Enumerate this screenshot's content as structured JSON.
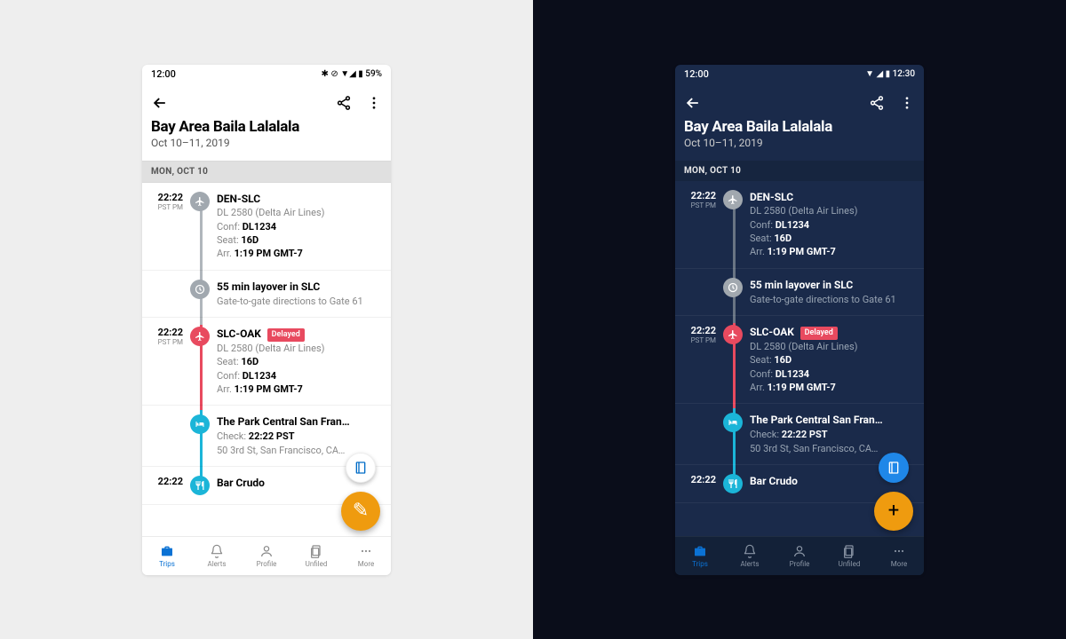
{
  "light": {
    "status": {
      "time": "12:00",
      "right": "✱ ⊘ ▼◢ ▮ 59%"
    },
    "header": {
      "title": "Bay Area Baila Lalalala",
      "dates": "Oct 10–11, 2019"
    },
    "section": "MON, OCT 10",
    "items": [
      {
        "time": "22:22",
        "tz": "PST PM",
        "route": "DEN-SLC",
        "lines": [
          "DL 2580 (Delta Air Lines)",
          "Conf: <b>DL1234</b>",
          "Seat: <b>16D</b>",
          "Arr. <b>1:19 PM GMT-7</b>"
        ],
        "color": "gray",
        "icon": "plane"
      },
      {
        "time": "",
        "tz": "",
        "route": "55 min layover in SLC",
        "lines": [
          "Gate-to-gate directions to Gate 61"
        ],
        "color": "gray",
        "icon": "clock"
      },
      {
        "time": "22:22",
        "tz": "PST PM",
        "route": "SLC-OAK",
        "badge": "Delayed",
        "lines": [
          "DL 2580 (Delta Air Lines)",
          "Seat: <b>16D</b>",
          "Conf: <b>DL1234</b>",
          "Arr. <b>1:19 PM GMT-7</b>"
        ],
        "color": "red",
        "icon": "plane"
      },
      {
        "time": "",
        "tz": "",
        "route": "The Park Central San Fran…",
        "lines": [
          "Check: <b>22:22 PST</b>",
          "50 3rd St, San Francisco, CA…"
        ],
        "color": "cyan",
        "icon": "bed"
      },
      {
        "time": "22:22",
        "tz": "",
        "route": "Bar Crudo",
        "lines": [],
        "color": "cyan",
        "icon": "fork"
      }
    ],
    "fab": {
      "small": "notebook",
      "large": "✎"
    },
    "nav": [
      {
        "label": "Trips",
        "active": true,
        "icon": "briefcase"
      },
      {
        "label": "Alerts",
        "icon": "bell"
      },
      {
        "label": "Profile",
        "icon": "person"
      },
      {
        "label": "Unfiled",
        "icon": "doc"
      },
      {
        "label": "More",
        "icon": "dots"
      }
    ]
  },
  "dark": {
    "status": {
      "time": "12:00",
      "right": "▼ ◢ ▮ 12:30"
    },
    "header": {
      "title": "Bay Area Baila Lalalala",
      "dates": "Oct 10–11, 2019"
    },
    "section": "MON, OCT 10",
    "items": [
      {
        "time": "22:22",
        "tz": "PST PM",
        "route": "DEN-SLC",
        "lines": [
          "DL 2580 (Delta Air Lines)",
          "Conf: <b>DL1234</b>",
          "Seat: <b>16D</b>",
          "Arr. <b>1:19 PM GMT-7</b>"
        ],
        "color": "gray",
        "icon": "plane"
      },
      {
        "time": "",
        "tz": "",
        "route": "55 min layover in SLC",
        "lines": [
          "Gate-to-gate directions to Gate 61"
        ],
        "color": "gray",
        "icon": "clock"
      },
      {
        "time": "22:22",
        "tz": "PST PM",
        "route": "SLC-OAK",
        "badge": "Delayed",
        "lines": [
          "DL 2580 (Delta Air Lines)",
          "Seat: <b>16D</b>",
          "Conf: <b>DL1234</b>",
          "Arr. <b>1:19 PM GMT-7</b>"
        ],
        "color": "red",
        "icon": "plane"
      },
      {
        "time": "",
        "tz": "",
        "route": "The Park Central San Fran…",
        "lines": [
          "Check: <b>22:22 PST</b>",
          "50 3rd St, San Francisco, CA…"
        ],
        "color": "cyan",
        "icon": "bed"
      },
      {
        "time": "22:22",
        "tz": "",
        "route": "Bar Crudo",
        "lines": [],
        "color": "cyan",
        "icon": "fork"
      }
    ],
    "fab": {
      "small": "notebook",
      "large": "+"
    },
    "nav": [
      {
        "label": "Trips",
        "active": true,
        "icon": "briefcase"
      },
      {
        "label": "Alerts",
        "icon": "bell"
      },
      {
        "label": "Profile",
        "icon": "person"
      },
      {
        "label": "Unfiled",
        "icon": "doc"
      },
      {
        "label": "More",
        "icon": "dots"
      }
    ]
  }
}
